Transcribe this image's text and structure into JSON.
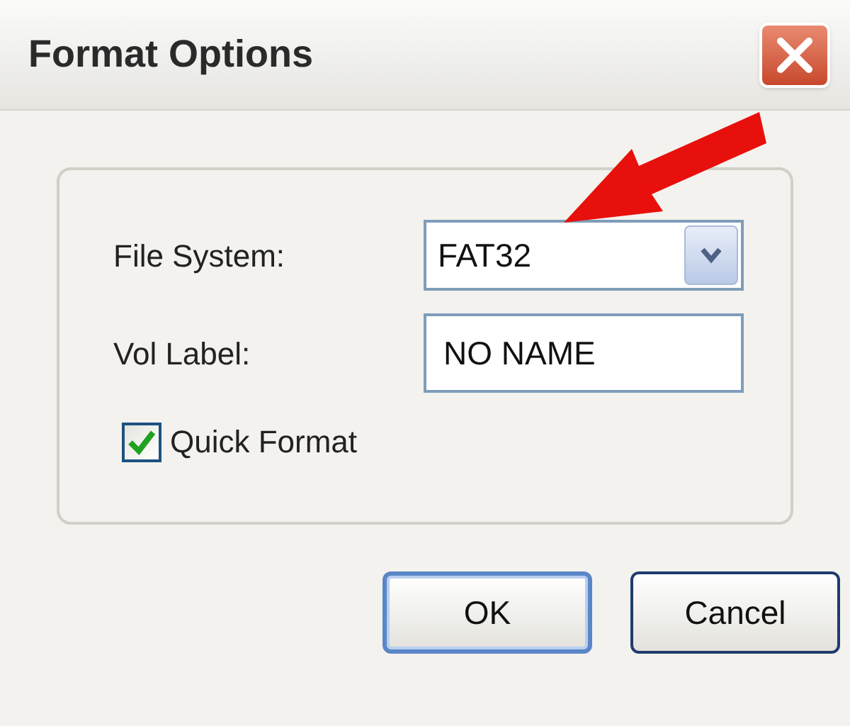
{
  "window": {
    "title": "Format Options"
  },
  "fields": [
    {
      "kind": "select",
      "label": "File System:",
      "value": "FAT32"
    },
    {
      "kind": "text",
      "label": "Vol Label:",
      "value": "NO NAME"
    }
  ],
  "quick_format": {
    "label": "Quick Format",
    "checked": true
  },
  "buttons": [
    {
      "label": "OK",
      "default": true
    },
    {
      "label": "Cancel",
      "default": false
    }
  ]
}
